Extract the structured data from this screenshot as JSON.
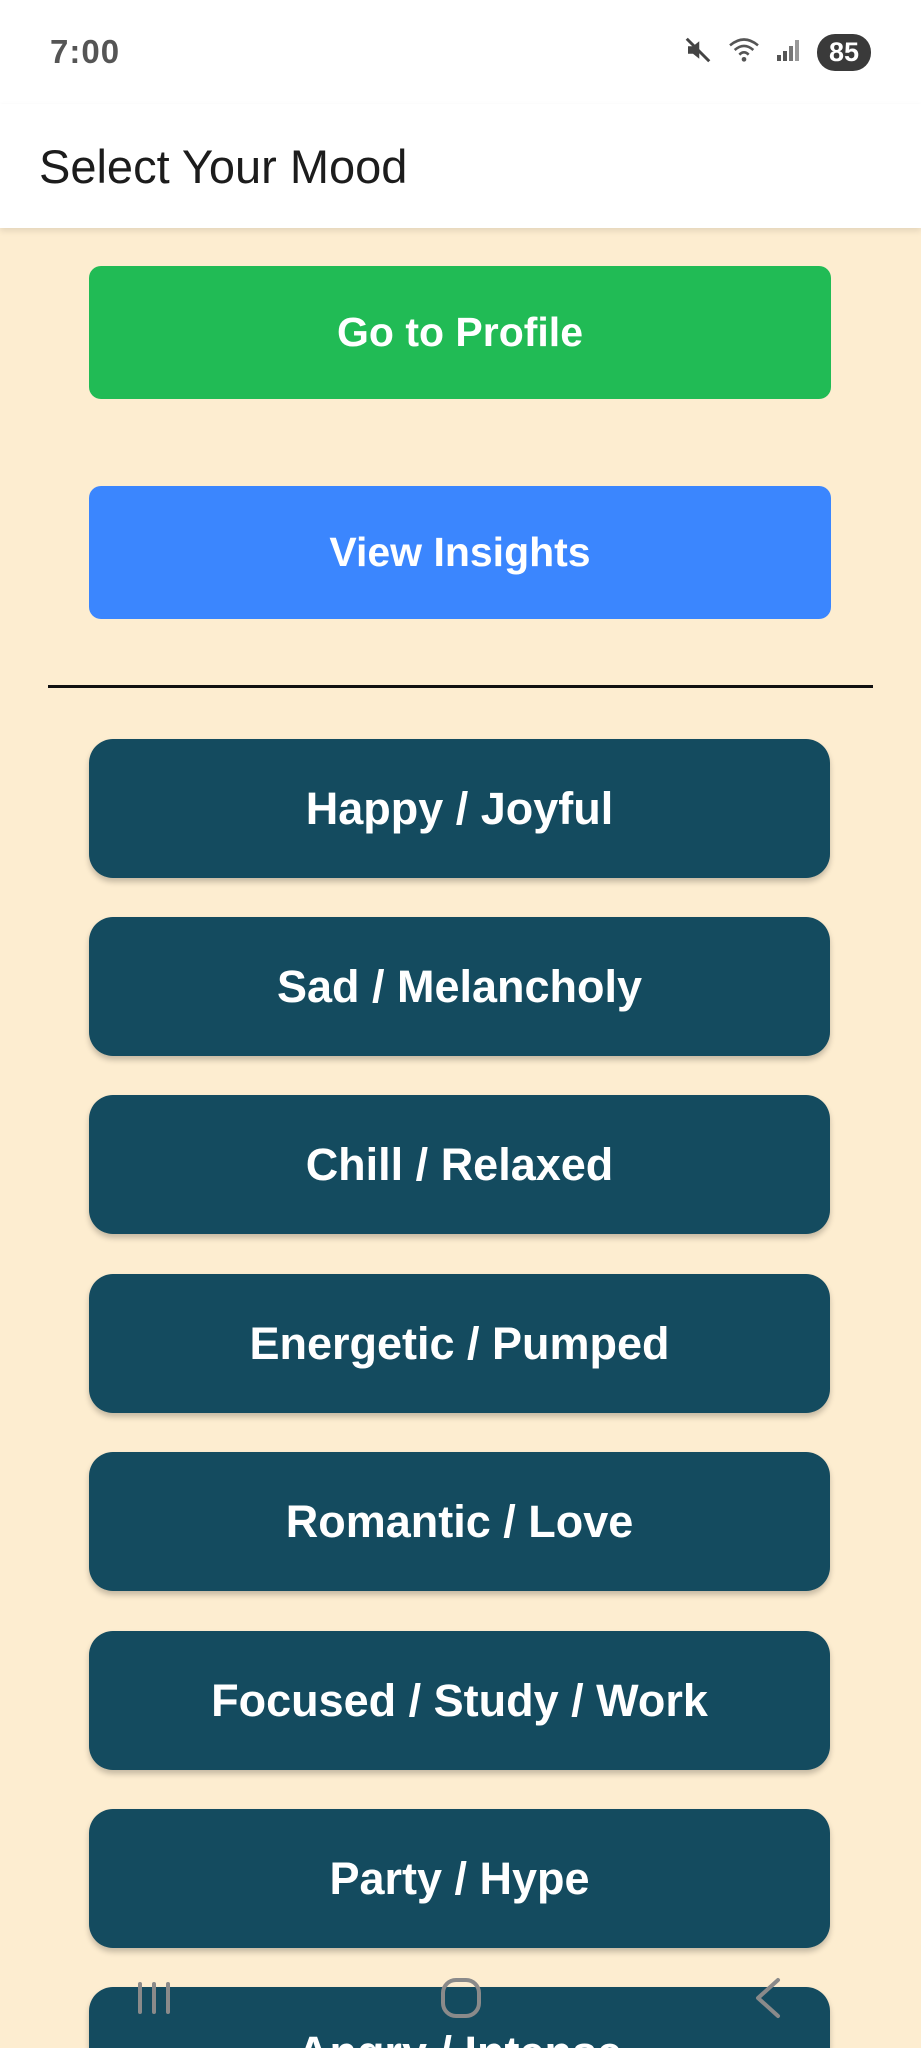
{
  "status_bar": {
    "time": "7:00",
    "battery": "85",
    "icons": [
      "mute-icon",
      "wifi-icon",
      "signal-icon",
      "battery-icon"
    ]
  },
  "app_bar": {
    "title": "Select Your Mood"
  },
  "actions": {
    "profile_label": "Go to Profile",
    "insights_label": "View Insights"
  },
  "moods": [
    "Happy / Joyful",
    "Sad / Melancholy",
    "Chill / Relaxed",
    "Energetic / Pumped",
    "Romantic / Love",
    "Focused / Study / Work",
    "Party / Hype",
    "Angry / Intense"
  ],
  "nav_bar": {
    "icons": [
      "recents-icon",
      "home-icon",
      "back-icon"
    ]
  },
  "colors": {
    "background": "#fdedd0",
    "profile_button": "#21bb55",
    "insights_button": "#3b86fe",
    "mood_button": "#144b5f"
  }
}
